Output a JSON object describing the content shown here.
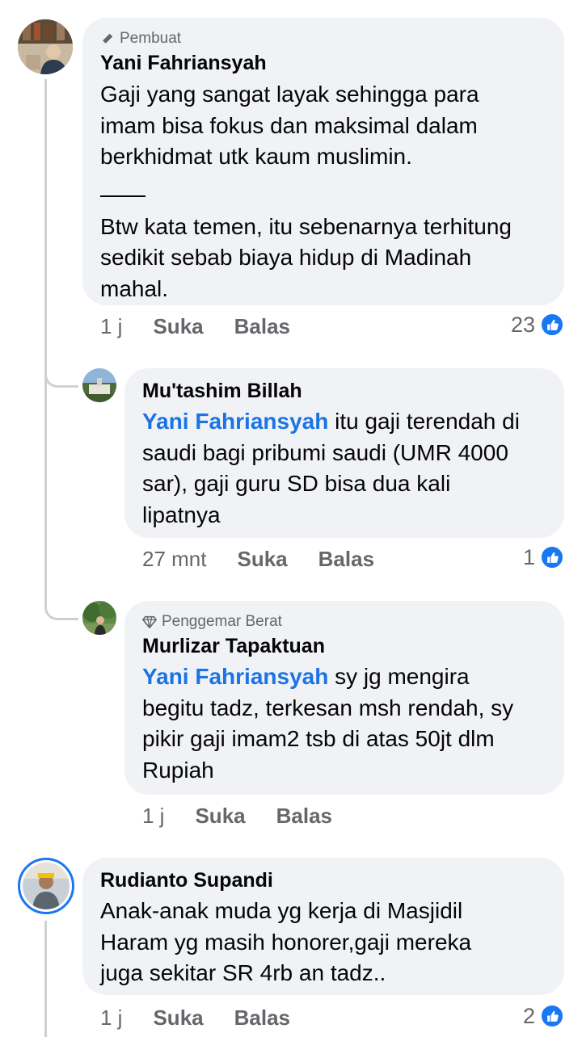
{
  "comments": [
    {
      "badge": "Pembuat",
      "author": "Yani Fahriansyah",
      "text_lines": [
        "Gaji yang sangat layak sehingga para",
        "imam bisa fokus dan maksimal dalam",
        "berkhidmat utk kaum muslimin."
      ],
      "text_lines_2": [
        "Btw kata temen, itu sebenarnya terhitung",
        "sedikit sebab biaya hidup di Madinah",
        "mahal."
      ],
      "time": "1 j",
      "like_label": "Suka",
      "reply_label": "Balas",
      "reactions": "23"
    },
    {
      "author": "Mu'tashim Billah",
      "mention": "Yani Fahriansyah",
      "text_first": " itu gaji terendah di",
      "text_lines": [
        "saudi bagi pribumi saudi (UMR 4000",
        "sar), gaji guru SD bisa dua kali",
        "lipatnya"
      ],
      "time": "27 mnt",
      "like_label": "Suka",
      "reply_label": "Balas",
      "reactions": "1"
    },
    {
      "badge": "Penggemar Berat",
      "author": "Murlizar Tapaktuan",
      "mention": "Yani Fahriansyah",
      "text_first": " sy jg mengira",
      "text_lines": [
        "begitu tadz, terkesan msh rendah, sy",
        "pikir gaji imam2 tsb di atas 50jt dlm",
        "Rupiah"
      ],
      "time": "1 j",
      "like_label": "Suka",
      "reply_label": "Balas"
    },
    {
      "author": "Rudianto Supandi",
      "text_lines": [
        "Anak-anak muda yg kerja di Masjidil",
        "Haram yg masih honorer,gaji mereka",
        "juga sekitar SR 4rb an tadz.."
      ],
      "time": "1 j",
      "like_label": "Suka",
      "reply_label": "Balas",
      "reactions": "2"
    }
  ],
  "colors": {
    "bubble": "#f0f2f5",
    "link": "#1b74e4",
    "meta": "#65676b",
    "like": "#1877f2"
  }
}
